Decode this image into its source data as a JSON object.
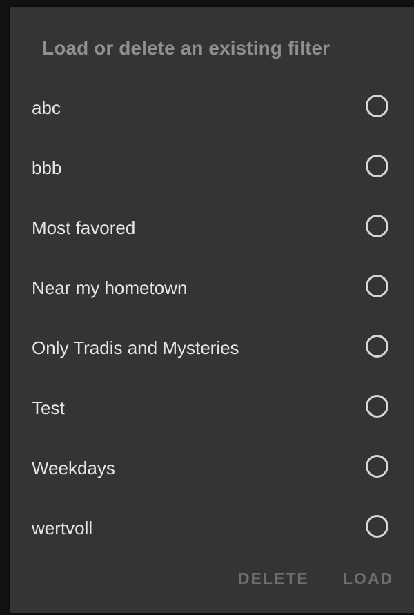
{
  "dialog": {
    "title": "Load or delete an existing filter",
    "filters": [
      {
        "label": "abc",
        "selected": false
      },
      {
        "label": "bbb",
        "selected": false
      },
      {
        "label": "Most favored",
        "selected": false
      },
      {
        "label": "Near my hometown",
        "selected": false
      },
      {
        "label": "Only Tradis and Mysteries",
        "selected": false
      },
      {
        "label": "Test",
        "selected": false
      },
      {
        "label": "Weekdays",
        "selected": false
      },
      {
        "label": "wertvoll",
        "selected": false
      }
    ],
    "actions": {
      "delete_label": "DELETE",
      "load_label": "LOAD"
    }
  },
  "colors": {
    "dialog_background": "#343434",
    "title_text": "#8f8f8f",
    "item_text": "#e6e6e6",
    "radio_outline": "#d6d6d6",
    "disabled_action_text": "#6f6f6f"
  },
  "icons": {
    "radio": "radio-unchecked-icon"
  }
}
